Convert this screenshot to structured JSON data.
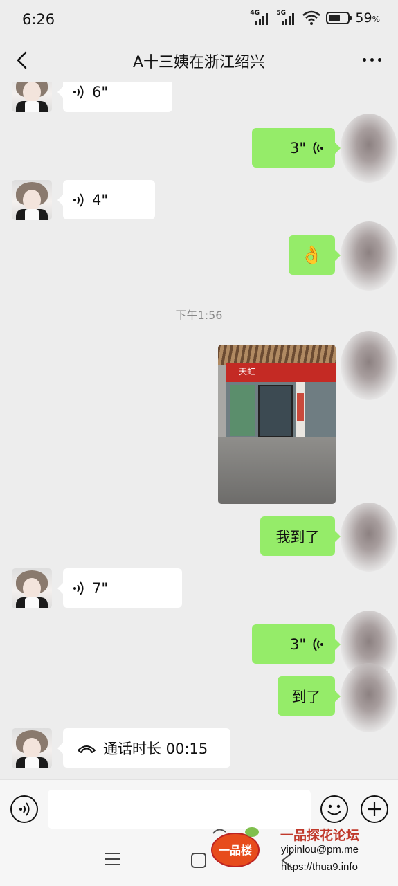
{
  "status_bar": {
    "time": "6:26",
    "signal1_label": "4G",
    "signal2_label": "5G",
    "battery_percent": 59,
    "battery_text": "59",
    "battery_unit": "%"
  },
  "header": {
    "title": "A十三姨在浙江绍兴",
    "back_icon": "chevron-left-icon",
    "more_icon": "more-dots-icon"
  },
  "messages": [
    {
      "side": "left",
      "type": "voice",
      "duration": "6\""
    },
    {
      "side": "right",
      "type": "voice",
      "duration": "3\""
    },
    {
      "side": "left",
      "type": "voice",
      "duration": "4\""
    },
    {
      "side": "right",
      "type": "emoji",
      "emoji": "👌"
    },
    {
      "type": "timestamp",
      "text": "下午1:56"
    },
    {
      "side": "right",
      "type": "image",
      "sign_text": "天虹"
    },
    {
      "side": "right",
      "type": "text",
      "text": "我到了"
    },
    {
      "side": "left",
      "type": "voice",
      "duration": "7\""
    },
    {
      "side": "right",
      "type": "voice",
      "duration": "3\""
    },
    {
      "side": "right",
      "type": "text",
      "text": "到了"
    },
    {
      "side": "left",
      "type": "call",
      "text": "通话时长 00:15"
    }
  ],
  "input_bar": {
    "voice_icon": "voice-mode-icon",
    "emoji_icon": "emoji-face-icon",
    "plus_icon": "plus-circle-icon",
    "placeholder": ""
  },
  "system_nav": {
    "menu_icon": "menu-lines-icon",
    "home_icon": "home-square-icon",
    "back_icon": "back-triangle-icon"
  },
  "watermark": {
    "logo_text": "一品楼",
    "title": "一品探花论坛",
    "email": "yipinlou@pm.me",
    "url": "https://thua9.info"
  },
  "colors": {
    "background": "#ededed",
    "bubble_right": "#95ec69",
    "bubble_left": "#ffffff",
    "watermark_red": "#c0392b"
  }
}
